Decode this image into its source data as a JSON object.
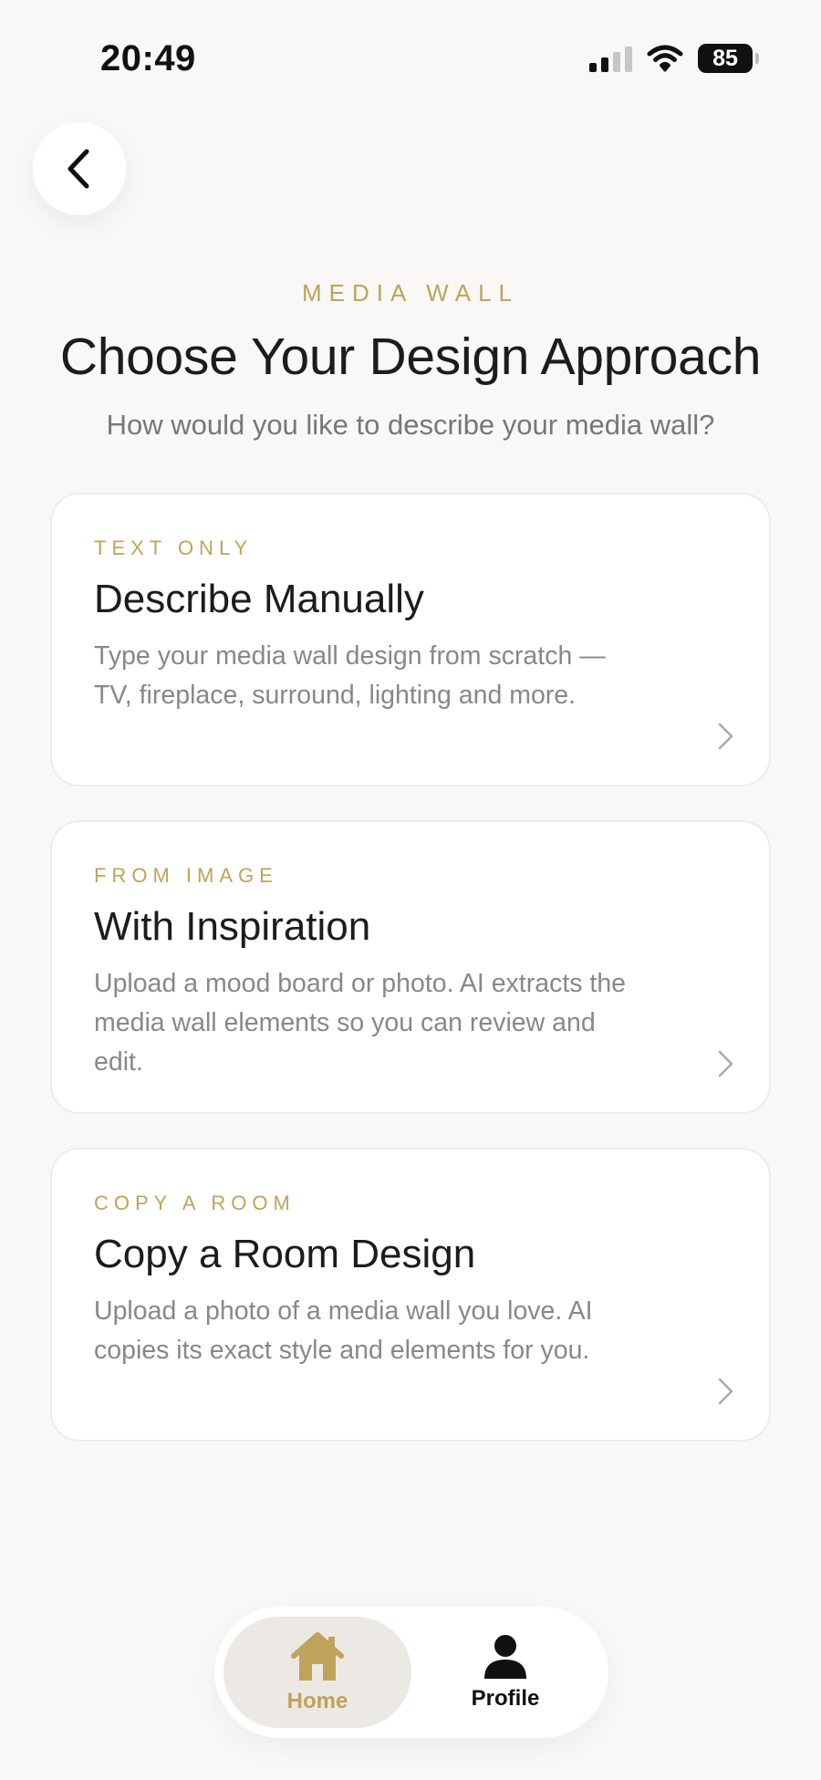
{
  "status": {
    "time": "20:49",
    "battery": "85"
  },
  "header": {
    "eyebrow": "MEDIA WALL",
    "title": "Choose Your Design Approach",
    "subtitle": "How would you like to describe your media wall?"
  },
  "options": [
    {
      "eyebrow": "TEXT ONLY",
      "title": "Describe Manually",
      "description": "Type your media wall design from scratch — TV, fireplace, surround, lighting and more."
    },
    {
      "eyebrow": "FROM IMAGE",
      "title": "With Inspiration",
      "description": "Upload a mood board or photo. AI extracts the media wall elements so you can review and edit."
    },
    {
      "eyebrow": "COPY A ROOM",
      "title": "Copy a Room Design",
      "description": "Upload a photo of a media wall you love. AI copies its exact style and elements for you."
    }
  ],
  "tabbar": {
    "home_label": "Home",
    "profile_label": "Profile"
  },
  "colors": {
    "accent": "#bfa35a",
    "background": "#f9f8f6",
    "card": "#ffffff",
    "active_tab": "#ece9e4"
  },
  "icons": [
    "back-chevron-icon",
    "chevron-right-icon",
    "home-icon",
    "person-icon",
    "signal-icon",
    "wifi-icon",
    "battery-icon"
  ]
}
